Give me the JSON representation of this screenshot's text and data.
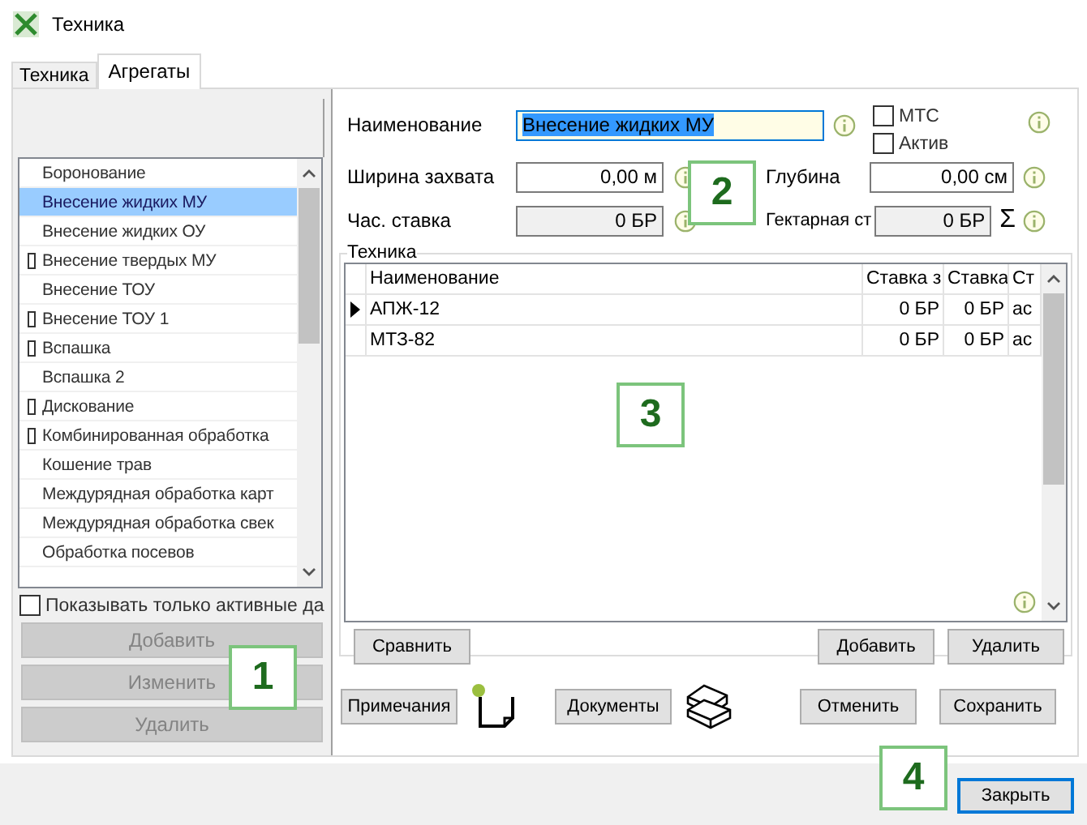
{
  "window": {
    "title": "Техника"
  },
  "tabs": [
    {
      "label": "Техника",
      "selected": false
    },
    {
      "label": "Агрегаты",
      "selected": true
    }
  ],
  "aggregates_list": {
    "items": [
      {
        "label": "Боронование",
        "selected": false,
        "marked": false
      },
      {
        "label": "Внесение жидких МУ",
        "selected": true,
        "marked": false
      },
      {
        "label": "Внесение жидких ОУ",
        "selected": false,
        "marked": false
      },
      {
        "label": "Внесение твердых МУ",
        "selected": false,
        "marked": true
      },
      {
        "label": "Внесение ТОУ",
        "selected": false,
        "marked": false
      },
      {
        "label": "Внесение ТОУ 1",
        "selected": false,
        "marked": true
      },
      {
        "label": "Вспашка",
        "selected": false,
        "marked": true
      },
      {
        "label": "Вспашка 2",
        "selected": false,
        "marked": false
      },
      {
        "label": "Дискование",
        "selected": false,
        "marked": true
      },
      {
        "label": "Комбинированная обработка",
        "selected": false,
        "marked": true
      },
      {
        "label": "Кошение трав",
        "selected": false,
        "marked": false
      },
      {
        "label": "Междурядная обработка карт",
        "selected": false,
        "marked": false
      },
      {
        "label": "Междурядная обработка свек",
        "selected": false,
        "marked": false
      },
      {
        "label": "Обработка посевов",
        "selected": false,
        "marked": false
      }
    ]
  },
  "active_only": {
    "label": "Показывать только активные да",
    "checked": false
  },
  "left_buttons": [
    {
      "label": "Добавить",
      "disabled": true
    },
    {
      "label": "Изменить",
      "disabled": true
    },
    {
      "label": "Удалить",
      "disabled": true
    }
  ],
  "form": {
    "name": {
      "label": "Наименование",
      "value": "Внесение жидких МУ",
      "text_selected": true
    },
    "checkboxes": [
      {
        "label": "МТС",
        "checked": false
      },
      {
        "label": "Актив",
        "checked": false
      }
    ],
    "width": {
      "label": "Ширина захвата",
      "value": "0,00 м",
      "readonly": false
    },
    "depth": {
      "label": "Глубина",
      "value": "0,00 см",
      "readonly": false
    },
    "hourly_rate": {
      "label": "Час. ставка",
      "value": "0 БР",
      "readonly": true
    },
    "hectare_rate": {
      "label": "Гектарная ст",
      "value": "0 БР",
      "readonly": true
    },
    "sum_symbol": "Σ"
  },
  "machinery": {
    "title": "Техника",
    "columns": [
      "Наименование",
      "Ставка з",
      "Ставка",
      "Ст"
    ],
    "rows": [
      {
        "current": true,
        "cells": [
          "АПЖ-12",
          "0 БР",
          "0 БР",
          "ас"
        ]
      },
      {
        "current": false,
        "cells": [
          "МТЗ-82",
          "0 БР",
          "0 БР",
          "ас"
        ]
      }
    ],
    "buttons": {
      "compare": "Сравнить",
      "add": "Добавить",
      "delete": "Удалить"
    }
  },
  "footer": {
    "notes": "Примечания",
    "documents": "Документы",
    "cancel": "Отменить",
    "save": "Сохранить"
  },
  "close_button": {
    "label": "Закрыть",
    "focused": true
  },
  "callouts": [
    "1",
    "2",
    "3",
    "4"
  ]
}
